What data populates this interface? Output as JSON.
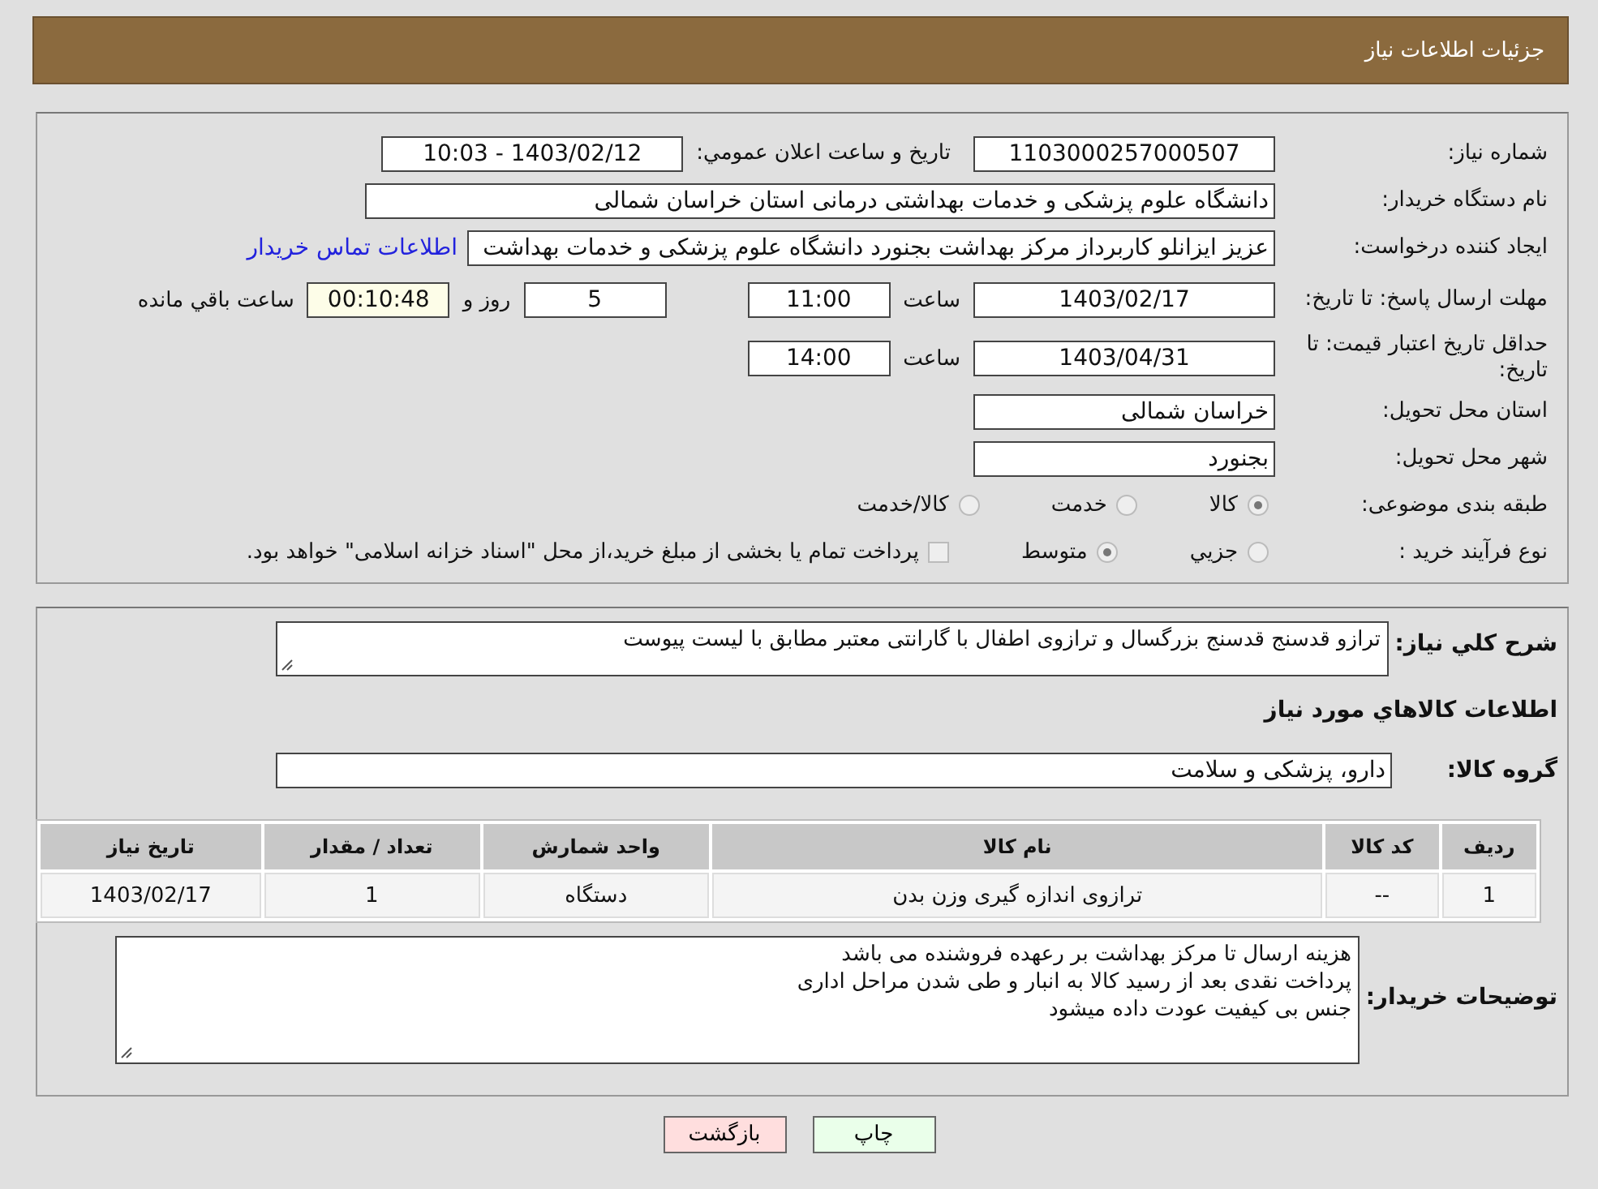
{
  "header": {
    "title": "جزئیات اطلاعات نیاز"
  },
  "need_number": {
    "label": "شماره نیاز:",
    "value": "1103000257000507"
  },
  "announce": {
    "label": "تاريخ و ساعت اعلان عمومي:",
    "value": "1403/02/12 - 10:03"
  },
  "buyer_org": {
    "label": "نام دستگاه خریدار:",
    "value": "دانشگاه علوم پزشکی و خدمات بهداشتی درمانی استان خراسان شمالی"
  },
  "requester": {
    "label": "ایجاد کننده درخواست:",
    "value": "عزیز ایزانلو کاربرداز مرکز بهداشت بجنورد دانشگاه علوم پزشکی و خدمات بهداشت",
    "link": "اطلاعات تماس خریدار"
  },
  "reply_deadline": {
    "label": "مهلت ارسال پاسخ: تا تاریخ:",
    "date": "1403/02/17",
    "time_label": "ساعت",
    "time": "11:00",
    "days": "5",
    "days_label": "روز و",
    "remaining": "00:10:48",
    "remaining_label": "ساعت باقي مانده"
  },
  "price_validity": {
    "label": "حداقل تاریخ اعتبار قیمت: تا تاریخ:",
    "date": "1403/04/31",
    "time_label": "ساعت",
    "time": "14:00"
  },
  "province": {
    "label": "استان محل تحویل:",
    "value": "خراسان شمالی"
  },
  "city": {
    "label": "شهر محل تحویل:",
    "value": "بجنورد"
  },
  "category": {
    "label": "طبقه بندی موضوعی:",
    "options": [
      {
        "label": "کالا",
        "selected": true
      },
      {
        "label": "خدمت",
        "selected": false
      },
      {
        "label": "کالا/خدمت",
        "selected": false
      }
    ]
  },
  "purchase_type": {
    "label": "نوع فرآیند خرید :",
    "options": [
      {
        "label": "جزيي",
        "selected": false
      },
      {
        "label": "متوسط",
        "selected": true
      }
    ],
    "treasury": {
      "checked": false,
      "label": "پرداخت تمام یا بخشی از مبلغ خرید،از محل \"اسناد خزانه اسلامی\" خواهد بود."
    }
  },
  "description": {
    "label": "شرح كلي نياز:",
    "value": "ترازو قدسنج قدسنج بزرگسال و ترازوی اطفال با گارانتی معتبر مطابق با لیست پیوست"
  },
  "goods_title": "اطلاعات كالاهاي مورد نياز",
  "goods_group": {
    "label": "گروه کالا:",
    "value": "دارو، پزشکی و سلامت"
  },
  "table": {
    "columns": [
      "رديف",
      "کد کالا",
      "نام کالا",
      "واحد شمارش",
      "تعداد / مقدار",
      "تاریخ نیاز"
    ],
    "rows": [
      [
        "1",
        "--",
        "ترازوی اندازه گیری وزن بدن",
        "دستگاه",
        "1",
        "1403/02/17"
      ]
    ]
  },
  "buyer_notes": {
    "label": "توضیحات خریدار:",
    "lines": [
      "هزینه ارسال تا مرکز بهداشت بر رعهده فروشنده می باشد",
      "پرداخت نقدی بعد از رسید کالا به انبار و طی شدن مراحل اداری",
      "جنس بی کیفیت عودت داده میشود"
    ]
  },
  "buttons": [
    {
      "kind": "print",
      "label": "چاپ"
    },
    {
      "kind": "back",
      "label": "بازگشت"
    }
  ]
}
